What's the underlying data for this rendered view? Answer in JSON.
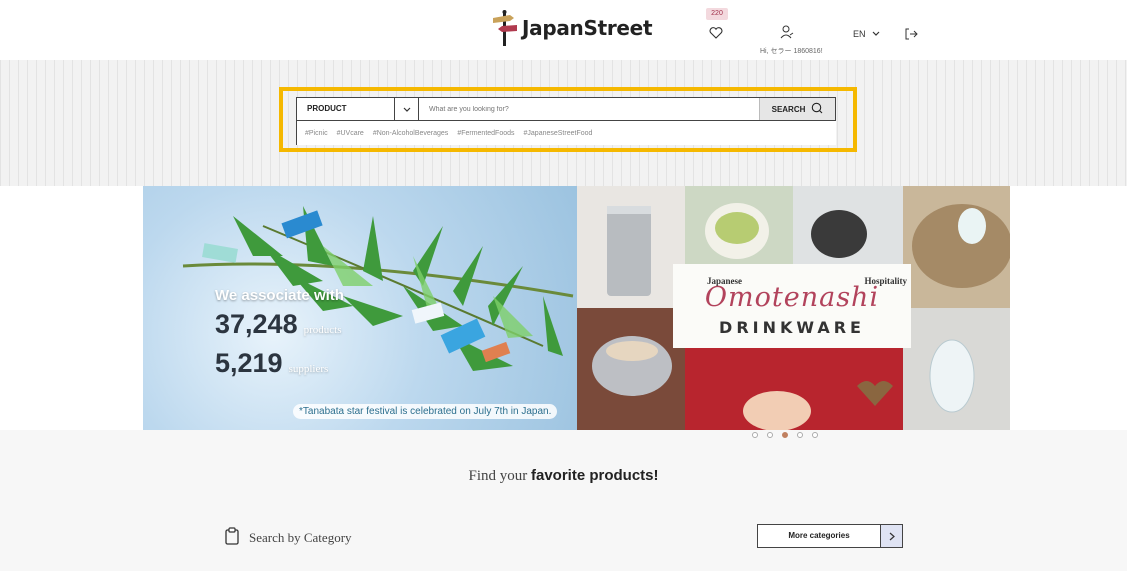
{
  "header": {
    "logo_text": "JapanStreet",
    "favorites_count": "220",
    "user_greeting": "Hi, セラー 1860816!",
    "language": "EN"
  },
  "search": {
    "category": "PRODUCT",
    "placeholder": "What are you looking for?",
    "button_label": "SEARCH",
    "tags": [
      "#Picnic",
      "#UVcare",
      "#Non-AlcoholBeverages",
      "#FermentedFoods",
      "#JapaneseStreetFood"
    ]
  },
  "banner_left": {
    "headline": "We associate with",
    "products_count": "37,248",
    "products_label": "products",
    "suppliers_count": "5,219",
    "suppliers_label": "suppliers",
    "note": "*Tanabata star festival is celebrated on July 7th in Japan."
  },
  "banner_right": {
    "tagline_left": "Japanese",
    "tagline_right": "Hospitality",
    "script_title": "Omotenashi",
    "title": "DRINKWARE"
  },
  "carousel": {
    "total": 5,
    "active": 3
  },
  "main": {
    "find_prefix": "Find your",
    "find_bold": "favorite products!",
    "category_label": "Search by Category",
    "more_categories": "More categories"
  },
  "colors": {
    "highlight": "#f5b800",
    "accent": "#a0304a"
  }
}
